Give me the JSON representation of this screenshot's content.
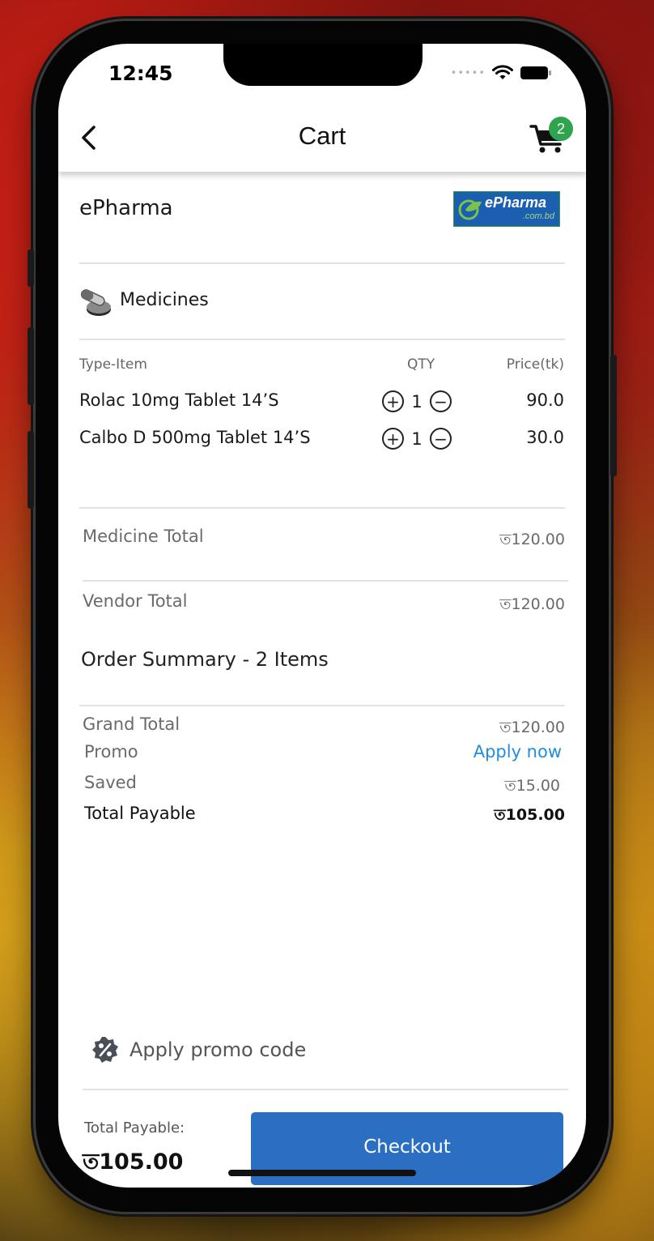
{
  "status_bar": {
    "time": "12:45"
  },
  "nav": {
    "title": "Cart",
    "cart_count": "2"
  },
  "vendor": {
    "name": "ePharma",
    "logo_text": "ePharma",
    "logo_sub": ".com.bd"
  },
  "section": {
    "title": "Medicines"
  },
  "table": {
    "headers": {
      "item": "Type-Item",
      "qty": "QTY",
      "price": "Price(tk)"
    },
    "rows": [
      {
        "name": "Rolac 10mg Tablet 14’S",
        "qty": "1",
        "price": "90.0"
      },
      {
        "name": "Calbo D 500mg Tablet 14’S",
        "qty": "1",
        "price": "30.0"
      }
    ]
  },
  "totals": {
    "medicine_total_label": "Medicine Total",
    "medicine_total_value": "ত120.00",
    "vendor_total_label": "Vendor Total",
    "vendor_total_value": "ত120.00"
  },
  "summary": {
    "title": "Order Summary - 2 Items",
    "grand_total_label": "Grand Total",
    "grand_total_value": "ত120.00",
    "promo_label": "Promo",
    "promo_action": "Apply now",
    "saved_label": "Saved",
    "saved_value": "ত15.00",
    "payable_label": "Total Payable",
    "payable_value": "ত105.00"
  },
  "promo_code": {
    "label": "Apply promo code"
  },
  "footer": {
    "payable_label": "Total Payable:",
    "payable_value": "ত105.00",
    "checkout_label": "Checkout"
  },
  "colors": {
    "accent": "#2b6fc2",
    "link": "#1f8de0",
    "badge": "#2ea44f"
  },
  "icons": [
    "back-chevron-icon",
    "cart-icon",
    "pill-icon",
    "plus-circle-icon",
    "minus-circle-icon",
    "percent-badge-icon",
    "wifi-icon",
    "battery-icon"
  ]
}
